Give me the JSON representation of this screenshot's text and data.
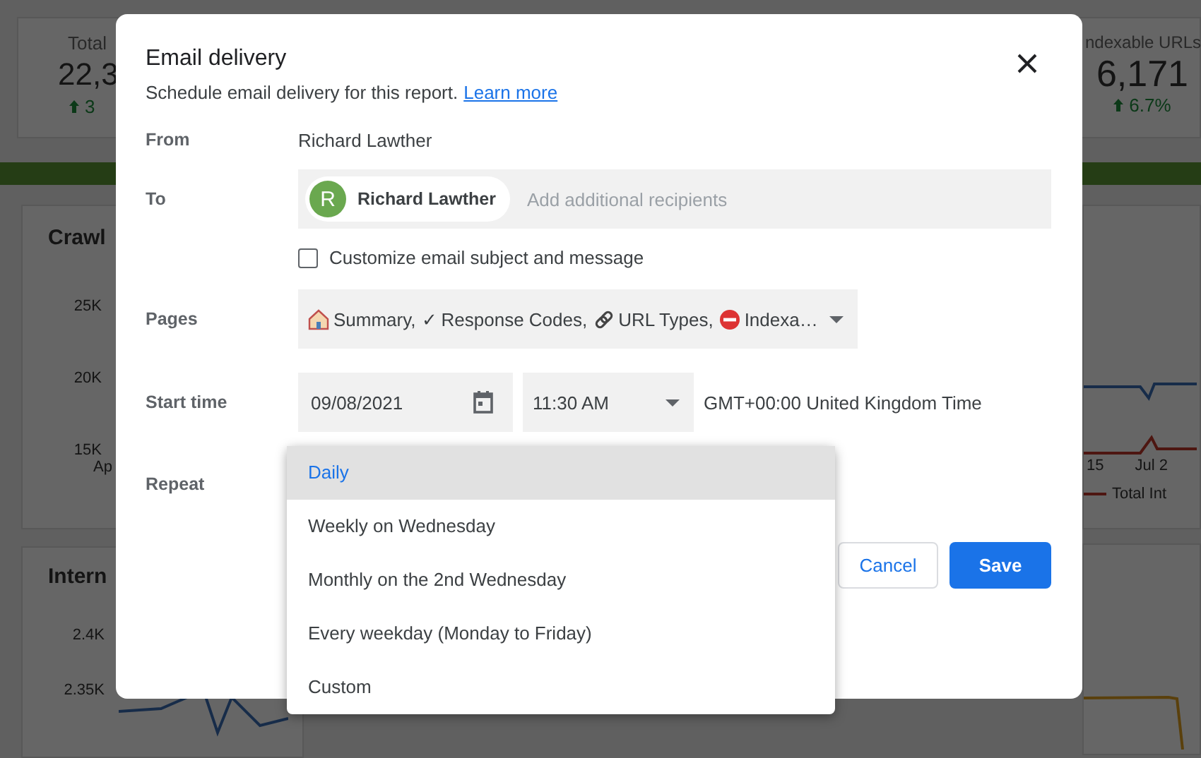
{
  "background": {
    "scorecards": [
      {
        "label": "Total",
        "value": "22,3",
        "change": "3"
      },
      {
        "label": "ndexable URLs",
        "value": "6,171",
        "change": "6.7%"
      }
    ],
    "charts": [
      {
        "title": "Crawl",
        "yticks": [
          "25K",
          "20K",
          "15K"
        ],
        "xlabels": [
          "Ap"
        ]
      },
      {
        "title": "Intern",
        "yticks": [
          "2.4K",
          "2.35K"
        ]
      }
    ],
    "right_chart": {
      "xlabels": [
        "15",
        "Jul 2"
      ],
      "legend": "Total Int"
    }
  },
  "dialog": {
    "title": "Email delivery",
    "subtitle": "Schedule email delivery for this report.",
    "link": "Learn more",
    "from": {
      "label": "From",
      "value": "Richard Lawther"
    },
    "to": {
      "label": "To",
      "chips": [
        {
          "initial": "R",
          "name": "Richard Lawther",
          "color": "#6aa84f"
        }
      ],
      "placeholder": "Add additional recipients"
    },
    "customize": {
      "label": "Customize email subject and message",
      "checked": false
    },
    "pages": {
      "label": "Pages",
      "items": [
        {
          "kind": "house",
          "text": "Summary,"
        },
        {
          "kind": "check",
          "mark": "✓",
          "text": "Response Codes,"
        },
        {
          "kind": "link",
          "text": "URL Types,"
        },
        {
          "kind": "stop",
          "text": "Indexa…"
        }
      ]
    },
    "start_time": {
      "label": "Start time",
      "date": "09/08/2021",
      "time": "11:30 AM",
      "zone": "GMT+00:00 United Kingdom Time"
    },
    "repeat": {
      "label": "Repeat",
      "options": [
        {
          "label": "Daily",
          "selected": true
        },
        {
          "label": "Weekly on Wednesday",
          "selected": false
        },
        {
          "label": "Monthly on the 2nd Wednesday",
          "selected": false
        },
        {
          "label": "Every weekday (Monday to Friday)",
          "selected": false
        },
        {
          "label": "Custom",
          "selected": false
        }
      ]
    },
    "buttons": [
      {
        "label": "Cancel",
        "kind": "secondary"
      },
      {
        "label": "Save",
        "kind": "primary"
      }
    ]
  }
}
